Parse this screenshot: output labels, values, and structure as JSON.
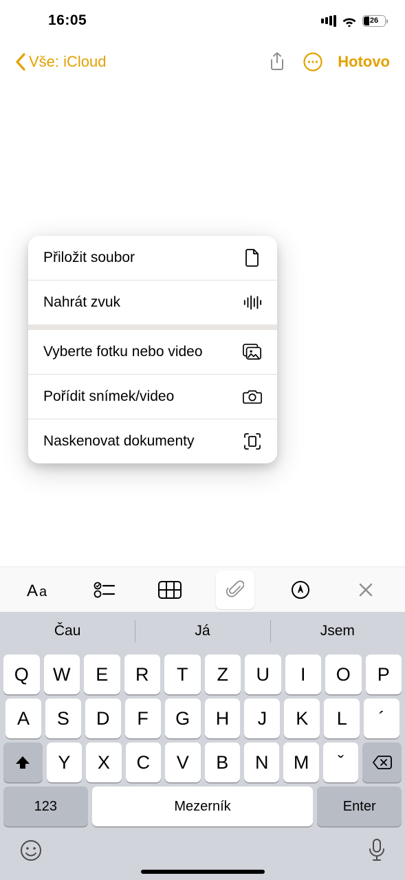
{
  "status": {
    "time": "16:05",
    "battery_pct": "26"
  },
  "nav": {
    "back_label": "Vše: iCloud",
    "done_label": "Hotovo"
  },
  "popover": {
    "attach_file": "Přiložit soubor",
    "record_audio": "Nahrát zvuk",
    "choose_media": "Vyberte fotku nebo video",
    "take_photo": "Pořídit snímek/video",
    "scan_docs": "Naskenovat dokumenty"
  },
  "predictions": {
    "p1": "Čau",
    "p2": "Já",
    "p3": "Jsem"
  },
  "keys": {
    "r1": {
      "k0": "Q",
      "k1": "W",
      "k2": "E",
      "k3": "R",
      "k4": "T",
      "k5": "Z",
      "k6": "U",
      "k7": "I",
      "k8": "O",
      "k9": "P"
    },
    "r2": {
      "k0": "A",
      "k1": "S",
      "k2": "D",
      "k3": "F",
      "k4": "G",
      "k5": "H",
      "k6": "J",
      "k7": "K",
      "k8": "L",
      "k9": "´"
    },
    "r3": {
      "k0": "Y",
      "k1": "X",
      "k2": "C",
      "k3": "V",
      "k4": "B",
      "k5": "N",
      "k6": "M",
      "k7": "ˇ"
    },
    "numbers": "123",
    "space": "Mezerník",
    "enter": "Enter"
  }
}
